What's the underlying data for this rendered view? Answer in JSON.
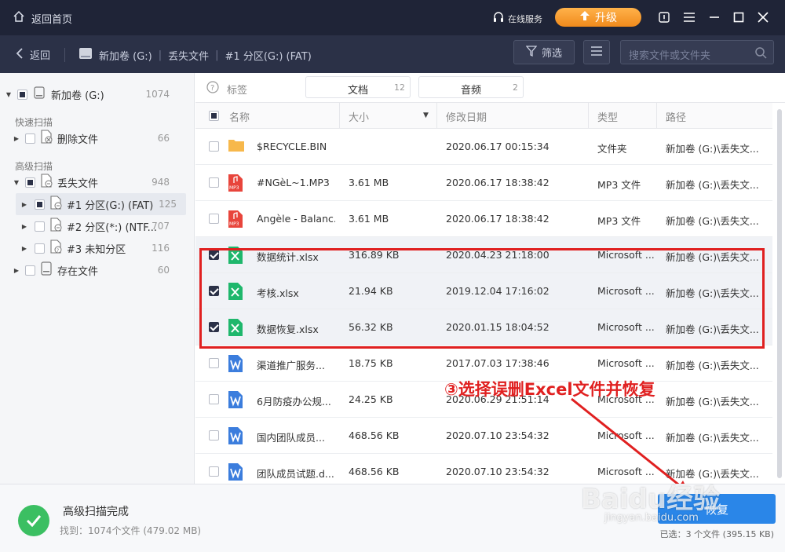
{
  "titlebar": {
    "home_label": "返回首页",
    "online_label": "在线服务",
    "upgrade_label": "升级"
  },
  "nav": {
    "back_label": "返回",
    "crumbs": [
      "新加卷 (G:)",
      "丢失文件",
      "#1 分区(G:) (FAT)"
    ],
    "filter_label": "筛选",
    "search_placeholder": "搜索文件或文件夹"
  },
  "sidebar": {
    "root": {
      "label": "新加卷 (G:)",
      "count": "1074"
    },
    "quick_label": "快速扫描",
    "deleted": {
      "label": "删除文件",
      "count": "66"
    },
    "advanced_label": "高级扫描",
    "lost": {
      "label": "丢失文件",
      "count": "948"
    },
    "partitions": [
      {
        "label": "#1 分区(G:) (FAT)",
        "count": "125"
      },
      {
        "label": "#2 分区(*:) (NTF...",
        "count": "707"
      },
      {
        "label": "#3 未知分区",
        "count": "116"
      }
    ],
    "existing": {
      "label": "存在文件",
      "count": "60"
    }
  },
  "tags": {
    "label": "标签",
    "items": [
      {
        "label": "文档",
        "count": "12"
      },
      {
        "label": "音频",
        "count": "2"
      }
    ]
  },
  "columns": {
    "name": "名称",
    "size": "大小",
    "date": "修改日期",
    "type": "类型",
    "path": "路径"
  },
  "rows": [
    {
      "name": "$RECYCLE.BIN",
      "size": "",
      "date": "2020.06.17 00:15:34",
      "type": "文件夹",
      "path": "新加卷 (G:)\\丢失文...",
      "icon": "folder",
      "checked": false
    },
    {
      "name": "#NGèL~1.MP3",
      "size": "3.61 MB",
      "date": "2020.06.17 18:38:42",
      "type": "MP3 文件",
      "path": "新加卷 (G:)\\丢失文...",
      "icon": "mp3",
      "checked": false
    },
    {
      "name": "Angèle - Balanc...",
      "size": "3.61 MB",
      "date": "2020.06.17 18:38:42",
      "type": "MP3 文件",
      "path": "新加卷 (G:)\\丢失文...",
      "icon": "mp3",
      "checked": false
    },
    {
      "name": "数据统计.xlsx",
      "size": "316.89 KB",
      "date": "2020.04.23 21:18:00",
      "type": "Microsoft ...",
      "path": "新加卷 (G:)\\丢失文...",
      "icon": "xlsx",
      "checked": true
    },
    {
      "name": "考核.xlsx",
      "size": "21.94 KB",
      "date": "2019.12.04 17:16:02",
      "type": "Microsoft ...",
      "path": "新加卷 (G:)\\丢失文...",
      "icon": "xlsx",
      "checked": true
    },
    {
      "name": "数据恢复.xlsx",
      "size": "56.32 KB",
      "date": "2020.01.15 18:04:52",
      "type": "Microsoft ...",
      "path": "新加卷 (G:)\\丢失文...",
      "icon": "xlsx",
      "checked": true
    },
    {
      "name": "渠道推广服务...",
      "size": "18.75 KB",
      "date": "2017.07.03 17:38:46",
      "type": "Microsoft ...",
      "path": "新加卷 (G:)\\丢失文...",
      "icon": "docx",
      "checked": false
    },
    {
      "name": "6月防疫办公规...",
      "size": "24.25 KB",
      "date": "2020.06.29 21:51:14",
      "type": "Microsoft ...",
      "path": "新加卷 (G:)\\丢失文...",
      "icon": "docx",
      "checked": false
    },
    {
      "name": "国内团队成员...",
      "size": "468.56 KB",
      "date": "2020.07.10 23:54:32",
      "type": "Microsoft ...",
      "path": "新加卷 (G:)\\丢失文...",
      "icon": "docx",
      "checked": false
    },
    {
      "name": "团队成员试题.d...",
      "size": "468.56 KB",
      "date": "2020.07.10 23:54:32",
      "type": "Microsoft ...",
      "path": "新加卷 (G:)\\丢失文...",
      "icon": "docx",
      "checked": false
    }
  ],
  "footer": {
    "status_title": "高级扫描完成",
    "status_detail": "找到：1074个文件 (479.02 MB)",
    "recover_label": "恢复",
    "selected_text": "已选：3 个文件 (395.15 KB)"
  },
  "annotation": "③选择误删Excel文件并恢复",
  "watermark": {
    "main": "Baidu经验",
    "sub": "jingyan.baidu.com"
  },
  "colors": {
    "titlebar": "#1f2437",
    "navbar": "#2b3147",
    "accent": "#2a86e8",
    "highlight": "#e02020",
    "excel": "#1fb76c",
    "word": "#3b7ddd",
    "mp3": "#e8453c",
    "folder": "#f7b84b"
  }
}
